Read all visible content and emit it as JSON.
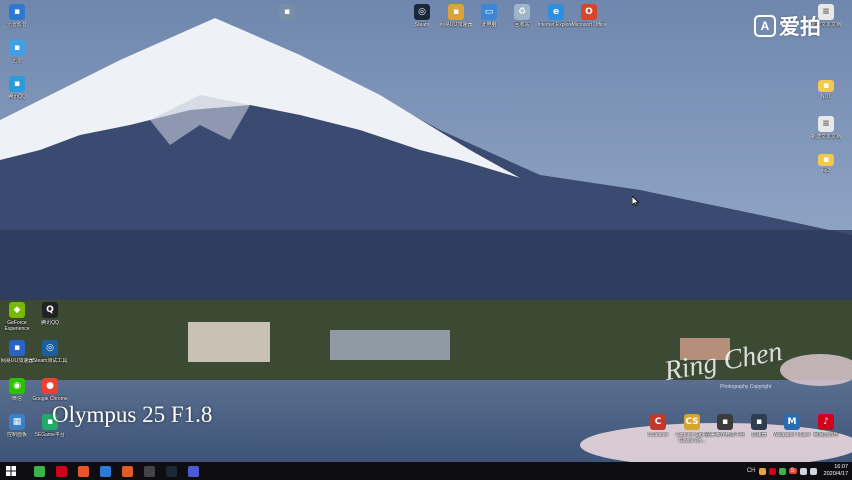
{
  "wallpaper": {
    "caption": "Olympus 25 F1.8",
    "signature": "Ring Chen",
    "signature_sub": "Photography Copyright"
  },
  "watermark": {
    "text": "爱拍"
  },
  "desktop_icons": [
    {
      "key": "steam",
      "label": "Steam",
      "icon": "steam-icon",
      "color": "#1b2838"
    },
    {
      "key": "nwf",
      "label": "网易UU加速器",
      "icon": "app-icon",
      "color": "#d9a23a"
    },
    {
      "key": "pc",
      "label": "此电脑",
      "icon": "computer-icon",
      "color": "#3b86d6"
    },
    {
      "key": "bin",
      "label": "回收站",
      "icon": "recycle-bin-icon",
      "color": "#9fb4c9"
    },
    {
      "key": "ie",
      "label": "Internet Explorer",
      "icon": "internet-explorer-icon",
      "color": "#2e8ee0"
    },
    {
      "key": "office",
      "label": "Microsoft Office",
      "icon": "office-icon",
      "color": "#d9452b"
    },
    {
      "key": "top1",
      "label": "",
      "icon": "app-icon",
      "color": "#7a8da8"
    },
    {
      "key": "left1",
      "label": "迅雷影音",
      "icon": "app-icon",
      "color": "#2f78d1"
    },
    {
      "key": "left2",
      "label": "迅雷",
      "icon": "app-icon",
      "color": "#3fa0e8"
    },
    {
      "key": "left3",
      "label": "腾讯QQ",
      "icon": "app-icon",
      "color": "#2b9bd9"
    },
    {
      "key": "nvidia",
      "label": "GeForce Experience",
      "icon": "nvidia-icon",
      "color": "#76b900"
    },
    {
      "key": "qq",
      "label": "腾讯QQ",
      "icon": "qq-icon",
      "color": "#222222"
    },
    {
      "key": "uu",
      "label": "网易UU加速器",
      "icon": "app-icon",
      "color": "#2a63c6"
    },
    {
      "key": "steamlink",
      "label": "Steam测试工具",
      "icon": "steam-icon",
      "color": "#1b5f9e"
    },
    {
      "key": "wechat",
      "label": "微信",
      "icon": "wechat-icon",
      "color": "#2dc100"
    },
    {
      "key": "chrome",
      "label": "Google Chrome",
      "icon": "chrome-icon",
      "color": "#e94235"
    },
    {
      "key": "ctrl",
      "label": "控制面板",
      "icon": "control-panel-icon",
      "color": "#3a7fc8"
    },
    {
      "key": "5e",
      "label": "5EGame平台",
      "icon": "app-icon",
      "color": "#22aa66"
    },
    {
      "key": "file1",
      "label": "新建文本文档",
      "icon": "document-icon",
      "color": "#e8e8e8"
    },
    {
      "key": "folder1",
      "label": "NO1",
      "icon": "folder-icon",
      "color": "#f2c94c"
    },
    {
      "key": "file2",
      "label": "新建文本文档",
      "icon": "document-icon",
      "color": "#e8e8e8"
    },
    {
      "key": "folder2",
      "label": "no2",
      "icon": "folder-icon",
      "color": "#f2c94c"
    },
    {
      "key": "ccleaner",
      "label": "CCleaner",
      "icon": "ccleaner-icon",
      "color": "#c0392b"
    },
    {
      "key": "csgo",
      "label": "Counter-Strike Global Off...",
      "icon": "csgo-icon",
      "color": "#d6a531"
    },
    {
      "key": "g1",
      "label": "完美世界竞技平台",
      "icon": "app-icon",
      "color": "#3b3b3b"
    },
    {
      "key": "g2",
      "label": "加速器",
      "icon": "app-icon",
      "color": "#2c3e50"
    },
    {
      "key": "wallpaper",
      "label": "Wallpaper Maker",
      "icon": "wallpaper-engine-icon",
      "color": "#2b6cb0"
    },
    {
      "key": "netease",
      "label": "网易云音乐",
      "icon": "netease-music-icon",
      "color": "#d0021b"
    }
  ],
  "taskbar": {
    "start_icon": "windows-icon",
    "apps": [
      {
        "icon": "360-icon",
        "color": "#3cb34a"
      },
      {
        "icon": "netease-music-icon",
        "color": "#d0021b"
      },
      {
        "icon": "app-icon",
        "color": "#e8552c"
      },
      {
        "icon": "app-icon",
        "color": "#2b7bd8"
      },
      {
        "icon": "app-icon",
        "color": "#e05a2a"
      },
      {
        "icon": "app-icon",
        "color": "#444444"
      },
      {
        "icon": "steam-icon",
        "color": "#1b2838"
      },
      {
        "icon": "app-icon",
        "color": "#4b5bd6"
      }
    ],
    "tray": {
      "lang": "CH",
      "ime": "S",
      "time": "16:07",
      "date": "2020/4/17"
    }
  }
}
